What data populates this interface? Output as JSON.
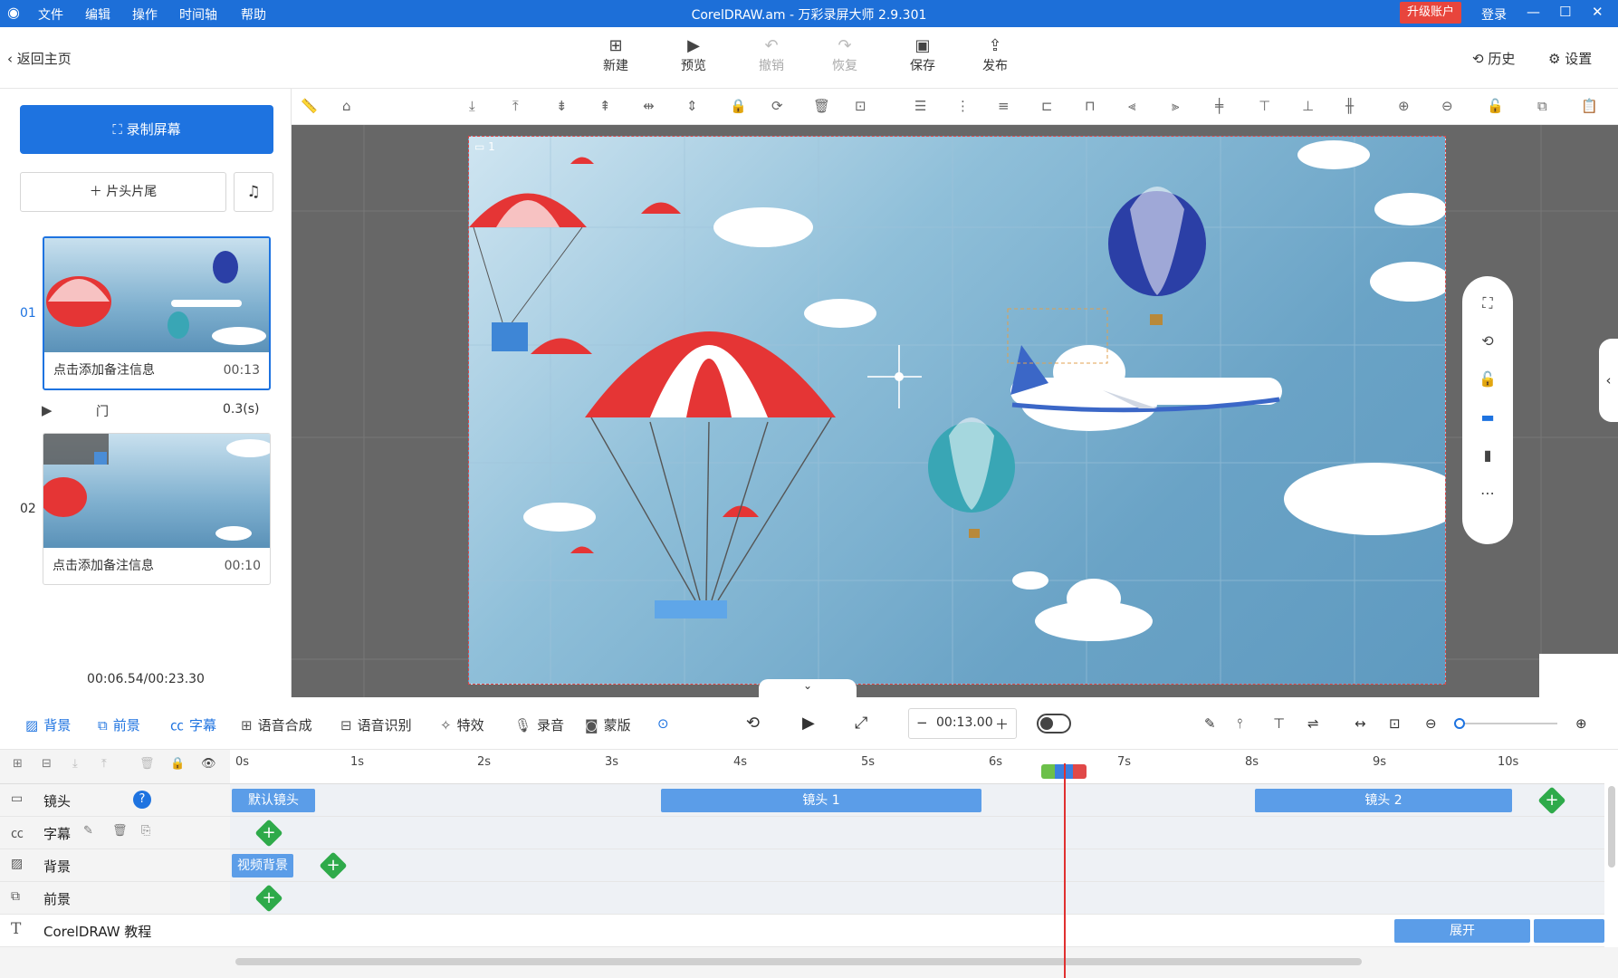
{
  "menubar": {
    "items": [
      "文件",
      "编辑",
      "操作",
      "时间轴",
      "帮助"
    ],
    "title": "CorelDRAW.am - 万彩录屏大师 2.9.301",
    "upgrade": "升级账户",
    "login": "登录"
  },
  "toolbar": {
    "back": "返回主页",
    "buttons": [
      {
        "label": "新建",
        "icon": "plus-square-icon"
      },
      {
        "label": "预览",
        "icon": "play-icon"
      },
      {
        "label": "撤销",
        "icon": "undo-icon"
      },
      {
        "label": "恢复",
        "icon": "redo-icon"
      },
      {
        "label": "保存",
        "icon": "save-icon"
      },
      {
        "label": "发布",
        "icon": "publish-icon"
      }
    ],
    "history": "历史",
    "settings": "设置"
  },
  "left": {
    "record": "录制屏幕",
    "add_intro": "片头片尾",
    "clips": [
      {
        "num": "01",
        "note": "点击添加备注信息",
        "duration": "00:13"
      },
      {
        "num": "02",
        "note": "点击添加备注信息",
        "duration": "00:10"
      }
    ],
    "transition": {
      "name": "门",
      "duration": "0.3(s)"
    },
    "total_time": "00:06.54/00:23.30"
  },
  "stage": {
    "camera_label": "1"
  },
  "tl_toolbar": {
    "tabs": [
      "背景",
      "前景",
      "字幕",
      "语音合成",
      "语音识别",
      "特效",
      "录音",
      "蒙版"
    ],
    "time": "00:13.00"
  },
  "ruler": {
    "ticks": [
      "0s",
      "1s",
      "2s",
      "3s",
      "4s",
      "5s",
      "6s",
      "7s",
      "8s",
      "9s",
      "10s"
    ]
  },
  "tracks": [
    {
      "name": "镜头",
      "blocks": [
        "默认镜头",
        "镜头 1",
        "镜头 2"
      ]
    },
    {
      "name": "字幕",
      "blocks": []
    },
    {
      "name": "背景",
      "blocks": [
        "视频背景"
      ]
    },
    {
      "name": "前景",
      "blocks": []
    },
    {
      "name": "CorelDRAW 教程",
      "blocks": [
        "展开"
      ]
    }
  ],
  "colors": {
    "accent": "#1e73e0",
    "menubar": "#1d6fd8",
    "upgrade": "#e8453c",
    "block": "#5b9de8",
    "add": "#2eaa4a",
    "playhead": "#e03030"
  }
}
